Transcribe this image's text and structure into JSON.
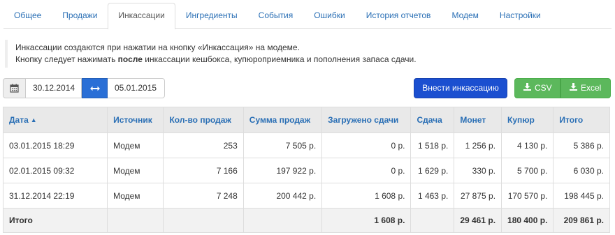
{
  "tabs": [
    {
      "label": "Общее",
      "active": false
    },
    {
      "label": "Продажи",
      "active": false
    },
    {
      "label": "Инкассации",
      "active": true
    },
    {
      "label": "Ингредиенты",
      "active": false
    },
    {
      "label": "События",
      "active": false
    },
    {
      "label": "Ошибки",
      "active": false
    },
    {
      "label": "История отчетов",
      "active": false
    },
    {
      "label": "Модем",
      "active": false
    },
    {
      "label": "Настройки",
      "active": false
    }
  ],
  "info": {
    "line1": "Инкассации создаются при нажатии на кнопку «Инкассация» на модеме.",
    "line2_before": "Кнопку следует нажимать ",
    "line2_bold": "после",
    "line2_after": " инкассации кешбокса, купюроприемника и пополнения запаса сдачи."
  },
  "date_filter": {
    "from": "30.12.2014",
    "to": "05.01.2015",
    "calendar_icon": "calendar-icon",
    "swap_icon": "swap-arrows-icon"
  },
  "buttons": {
    "add_collection": "Внести инкассацию",
    "csv": "CSV",
    "excel": "Excel",
    "download_icon": "download-icon"
  },
  "table": {
    "columns": [
      "Дата",
      "Источник",
      "Кол-во продаж",
      "Сумма продаж",
      "Загружено сдачи",
      "Сдача",
      "Монет",
      "Купюр",
      "Итого"
    ],
    "sort_icon": "sort-up-icon",
    "rows": [
      [
        "03.01.2015 18:29",
        "Модем",
        "253",
        "7 505 р.",
        "0 р.",
        "1 518 р.",
        "1 256 р.",
        "4 130 р.",
        "5 386 р."
      ],
      [
        "02.01.2015 09:32",
        "Модем",
        "7 166",
        "197 922 р.",
        "0 р.",
        "1 629 р.",
        "330 р.",
        "5 700 р.",
        "6 030 р."
      ],
      [
        "31.12.2014 22:19",
        "Модем",
        "7 248",
        "200 442 р.",
        "1 608 р.",
        "1 463 р.",
        "27 875 р.",
        "170 570 р.",
        "198 445 р."
      ]
    ],
    "footer": [
      "Итого",
      "",
      "",
      "",
      "1 608 р.",
      "",
      "29 461 р.",
      "180 400 р.",
      "209 861 р."
    ]
  }
}
